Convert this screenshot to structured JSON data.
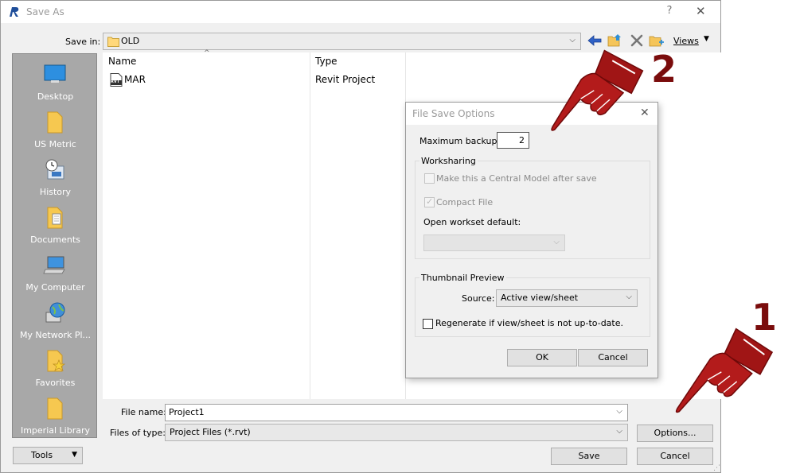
{
  "window": {
    "title": "Save As"
  },
  "toolbar": {
    "save_in_label": "Save in:",
    "folder": "OLD",
    "views_label": "Views"
  },
  "places": [
    {
      "label": "Desktop",
      "icon": "desktop-icon"
    },
    {
      "label": "US Metric",
      "icon": "folder-icon"
    },
    {
      "label": "History",
      "icon": "history-icon"
    },
    {
      "label": "Documents",
      "icon": "documents-icon"
    },
    {
      "label": "My Computer",
      "icon": "computer-icon"
    },
    {
      "label": "My Network Pl...",
      "icon": "network-icon"
    },
    {
      "label": "Favorites",
      "icon": "favorites-icon"
    },
    {
      "label": "Imperial Library",
      "icon": "folder-icon"
    }
  ],
  "file_list": {
    "columns": [
      "Name",
      "Type"
    ],
    "rows": [
      {
        "name": "MAR",
        "type": "Revit Project",
        "icon_text": "RVT"
      }
    ]
  },
  "bottom": {
    "file_name_label": "File name:",
    "file_name_value": "Project1",
    "file_type_label": "Files of type:",
    "file_type_value": "Project Files  (*.rvt)",
    "options_button": "Options...",
    "tools_button": "Tools",
    "save_button": "Save",
    "cancel_button": "Cancel"
  },
  "options_dialog": {
    "title": "File Save Options",
    "max_backups_label": "Maximum backups:",
    "max_backups_value": "2",
    "worksharing_title": "Worksharing",
    "central_model_label": "Make this a Central Model after save",
    "compact_file_label": "Compact File",
    "open_workset_label": "Open workset default:",
    "thumbnail_title": "Thumbnail Preview",
    "source_label": "Source:",
    "source_value": "Active view/sheet",
    "regenerate_label": "Regenerate if view/sheet is not up-to-date.",
    "ok_button": "OK",
    "cancel_button": "Cancel"
  },
  "annotations": {
    "step1": "1",
    "step2": "2"
  },
  "colors": {
    "accent_hand": "#a01515",
    "number": "#7a0c0c",
    "places_bg": "#a8a8a8"
  }
}
